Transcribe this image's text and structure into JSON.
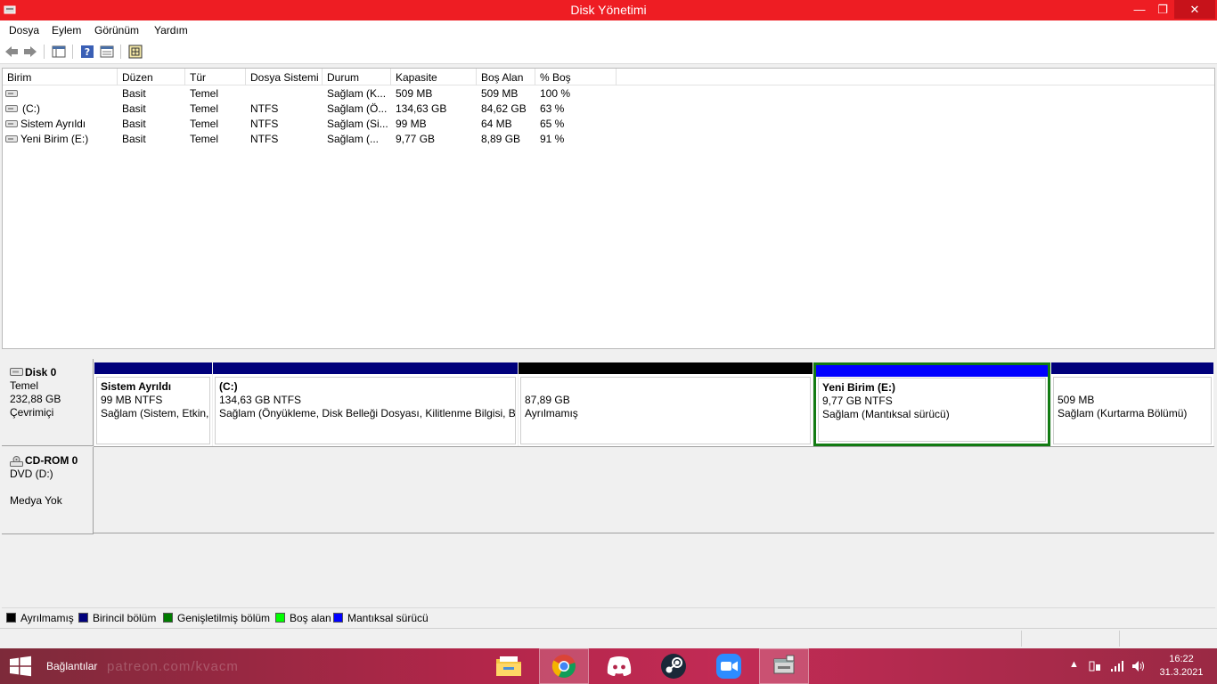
{
  "window": {
    "title": "Disk Yönetimi"
  },
  "menu": [
    "Dosya",
    "Eylem",
    "Görünüm",
    "Yardım"
  ],
  "columns": [
    "Birim",
    "Düzen",
    "Tür",
    "Dosya Sistemi",
    "Durum",
    "Kapasite",
    "Boş Alan",
    "% Boş"
  ],
  "volumes": [
    {
      "birim": "",
      "duzen": "Basit",
      "tur": "Temel",
      "fs": "",
      "durum": "Sağlam (K...",
      "kapasite": "509 MB",
      "bos": "509 MB",
      "yuzde": "100 %"
    },
    {
      "birim": "(C:)",
      "duzen": "Basit",
      "tur": "Temel",
      "fs": "NTFS",
      "durum": "Sağlam (Ö...",
      "kapasite": "134,63 GB",
      "bos": "84,62 GB",
      "yuzde": "63 %"
    },
    {
      "birim": "Sistem Ayrıldı",
      "duzen": "Basit",
      "tur": "Temel",
      "fs": "NTFS",
      "durum": "Sağlam (Si...",
      "kapasite": "99 MB",
      "bos": "64 MB",
      "yuzde": "65 %"
    },
    {
      "birim": "Yeni Birim (E:)",
      "duzen": "Basit",
      "tur": "Temel",
      "fs": "NTFS",
      "durum": "Sağlam (...",
      "kapasite": "9,77 GB",
      "bos": "8,89 GB",
      "yuzde": "91 %"
    }
  ],
  "disk0": {
    "name": "Disk 0",
    "type": "Temel",
    "size": "232,88 GB",
    "status": "Çevrimiçi"
  },
  "partitions": [
    {
      "name": "Sistem Ayrıldı",
      "size": "99 MB NTFS",
      "status": "Sağlam (Sistem, Etkin, ",
      "bar_color": "#00007b"
    },
    {
      "name": "(C:)",
      "size": "134,63 GB NTFS",
      "status": "Sağlam (Önyükleme, Disk Belleği Dosyası, Kilitlenme Bilgisi, Bi",
      "bar_color": "#00007b"
    },
    {
      "name": "",
      "size": "87,89 GB",
      "status": "Ayrılmamış",
      "bar_color": "#000000"
    },
    {
      "name": "Yeni Birim  (E:)",
      "size": "9,77 GB NTFS",
      "status": "Sağlam (Mantıksal sürücü)",
      "bar_color": "#0000ff"
    },
    {
      "name": "",
      "size": "509 MB",
      "status": "Sağlam (Kurtarma Bölümü)",
      "bar_color": "#00007b"
    }
  ],
  "cdrom": {
    "name": "CD-ROM 0",
    "type": "DVD (D:)",
    "status": "Medya Yok"
  },
  "legend": [
    {
      "label": "Ayrılmamış",
      "color": "#000000"
    },
    {
      "label": "Birincil bölüm",
      "color": "#00007b"
    },
    {
      "label": "Genişletilmiş bölüm",
      "color": "#007b00"
    },
    {
      "label": "Boş alan",
      "color": "#00ff00"
    },
    {
      "label": "Mantıksal sürücü",
      "color": "#0000ff"
    }
  ],
  "taskbar": {
    "label": "Bağlantılar",
    "watermark": "patreon.com/kvacm",
    "time": "16:22",
    "date": "31.3.2021"
  }
}
